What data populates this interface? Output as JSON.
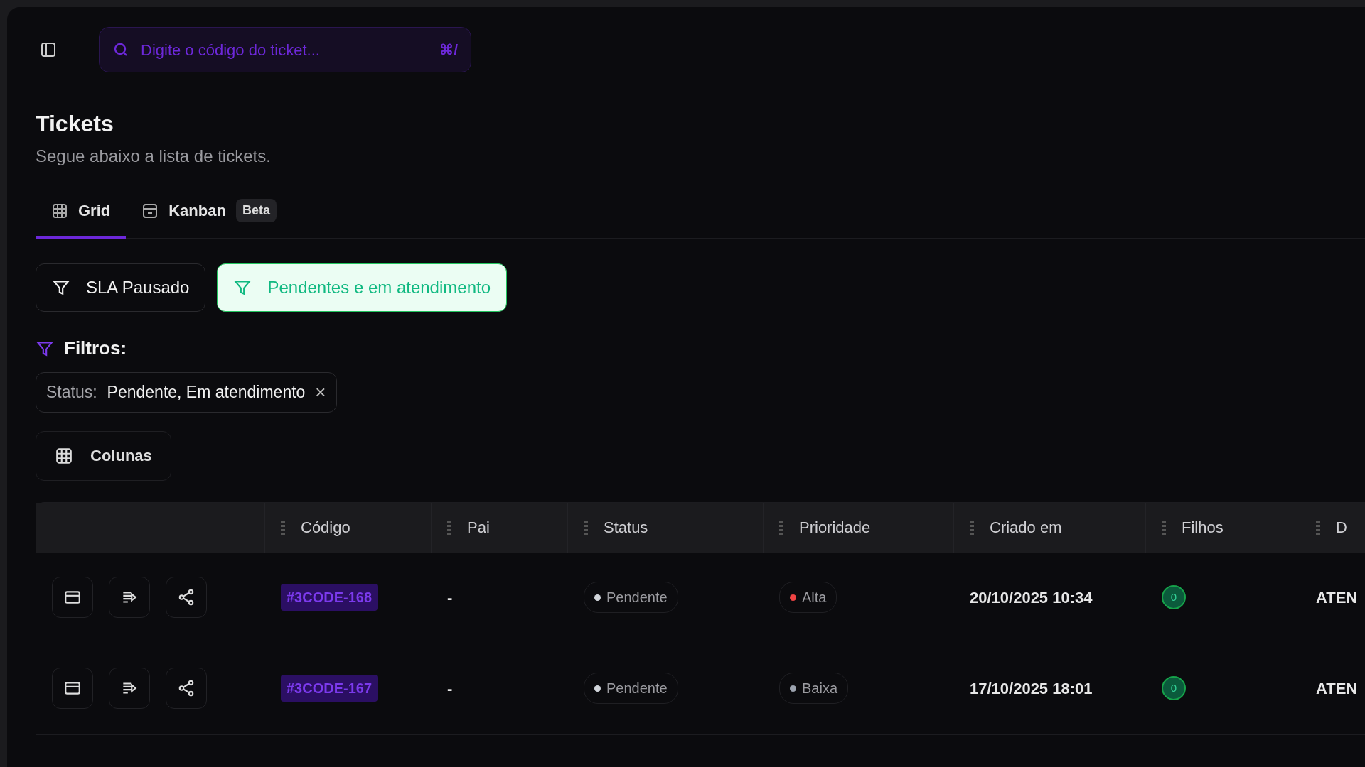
{
  "search": {
    "placeholder": "Digite o código do ticket...",
    "shortcut": "⌘/"
  },
  "header": {
    "title": "Tickets",
    "subtitle": "Segue abaixo a lista de tickets."
  },
  "tabs": [
    {
      "label": "Grid",
      "selected": true
    },
    {
      "label": "Kanban",
      "selected": false,
      "badge": "Beta"
    }
  ],
  "quick_filters": [
    {
      "label": "SLA Pausado",
      "selected": false
    },
    {
      "label": "Pendentes e em atendimento",
      "selected": true
    }
  ],
  "filters": {
    "title": "Filtros:",
    "chips": [
      {
        "label": "Status:",
        "value": "Pendente, Em atendimento",
        "remove": "×"
      }
    ]
  },
  "columns_button": "Colunas",
  "table": {
    "columns": [
      "",
      "Código",
      "Pai",
      "Status",
      "Prioridade",
      "Criado em",
      "Filhos",
      "D"
    ],
    "rows": [
      {
        "code": "#3CODE-168",
        "parent": "-",
        "status": {
          "label": "Pendente",
          "color": "#d1d5db"
        },
        "priority": {
          "label": "Alta",
          "color": "#ef4444"
        },
        "created": "20/10/2025 10:34",
        "children": "0",
        "column_8": "ATEN"
      },
      {
        "code": "#3CODE-167",
        "parent": "-",
        "status": {
          "label": "Pendente",
          "color": "#d1d5db"
        },
        "priority": {
          "label": "Baixa",
          "color": "#9ca3af"
        },
        "created": "17/10/2025 18:01",
        "children": "0",
        "column_8": "ATEN"
      }
    ]
  }
}
